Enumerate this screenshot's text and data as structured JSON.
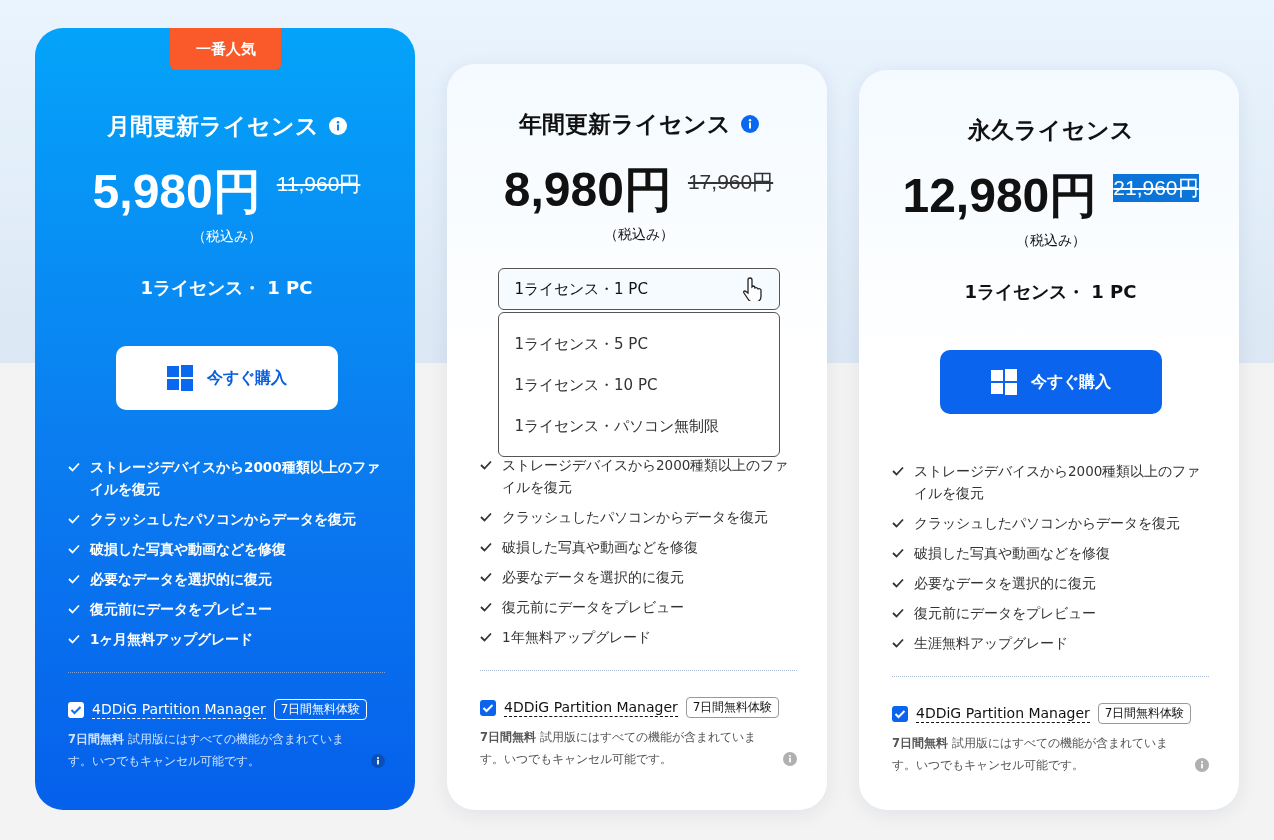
{
  "plans": [
    {
      "featured": true,
      "badge": "一番人気",
      "title": "月間更新ライセンス",
      "title_info": true,
      "price": "5,980円",
      "old_price": "11,960円",
      "old_price_selected": false,
      "tax": "（税込み）",
      "license": {
        "kind": "text",
        "label": "1ライセンス・ 1 PC"
      },
      "buy_button": "今すぐ購入",
      "features": [
        "ストレージデバイスから2000種類以上のファイルを復元",
        "クラッシュしたパソコンからデータを復元",
        "破損した写真や動画などを修復",
        "必要なデータを選択的に復元",
        "復元前にデータをプレビュー",
        "1ヶ月無料アップグレード"
      ],
      "addon": {
        "checked": true,
        "name": "4DDiG Partition Manager",
        "tag": "7日間無料体験",
        "note_bold": "7日間無料",
        "note": "試用版にはすべての機能が含まれています。いつでもキャンセル可能です。"
      }
    },
    {
      "featured": false,
      "title": "年間更新ライセンス",
      "title_info": true,
      "price": "8,980円",
      "old_price": "17,960円",
      "old_price_selected": false,
      "tax": "（税込み）",
      "license": {
        "kind": "select",
        "label": "1ライセンス・1 PC",
        "expanded": true,
        "options": [
          "1ライセンス・5 PC",
          "1ライセンス・10 PC",
          "1ライセンス・パソコン無制限"
        ]
      },
      "features": [
        "ストレージデバイスから2000種類以上のファイルを復元",
        "クラッシュしたパソコンからデータを復元",
        "破損した写真や動画などを修復",
        "必要なデータを選択的に復元",
        "復元前にデータをプレビュー",
        "1年無料アップグレード"
      ],
      "addon": {
        "checked": true,
        "name": "4DDiG Partition Manager",
        "tag": "7日間無料体験",
        "note_bold": "7日間無料",
        "note": "試用版にはすべての機能が含まれています。いつでもキャンセル可能です。"
      }
    },
    {
      "featured": false,
      "title": "永久ライセンス",
      "title_info": false,
      "price": "12,980円",
      "old_price": "21,960円",
      "old_price_selected": true,
      "tax": "（税込み）",
      "license": {
        "kind": "text",
        "label": "1ライセンス・ 1 PC"
      },
      "buy_button": "今すぐ購入",
      "features": [
        "ストレージデバイスから2000種類以上のファイルを復元",
        "クラッシュしたパソコンからデータを復元",
        "破損した写真や動画などを修復",
        "必要なデータを選択的に復元",
        "復元前にデータをプレビュー",
        "生涯無料アップグレード"
      ],
      "addon": {
        "checked": true,
        "name": "4DDiG Partition Manager",
        "tag": "7日間無料体験",
        "note_bold": "7日間無料",
        "note": "試用版にはすべての機能が含まれています。いつでもキャンセル可能です。"
      }
    }
  ]
}
